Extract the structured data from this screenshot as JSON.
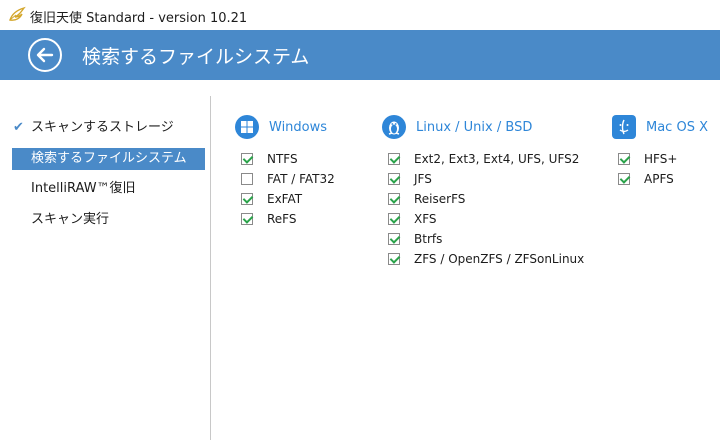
{
  "window": {
    "title": "復旧天使 Standard - version 10.21"
  },
  "header": {
    "title": "検索するファイルシステム"
  },
  "sidebar": {
    "items": [
      {
        "label": "スキャンするストレージ",
        "done": true,
        "active": false
      },
      {
        "label": "検索するファイルシステム",
        "done": false,
        "active": true
      },
      {
        "label": "IntelliRAW™復旧",
        "done": false,
        "active": false
      },
      {
        "label": "スキャン実行",
        "done": false,
        "active": false
      }
    ]
  },
  "filesystems": {
    "windows": {
      "title": "Windows",
      "icon": "windows-icon",
      "items": [
        {
          "label": "NTFS",
          "checked": true
        },
        {
          "label": "FAT / FAT32",
          "checked": false
        },
        {
          "label": "ExFAT",
          "checked": true
        },
        {
          "label": "ReFS",
          "checked": true
        }
      ]
    },
    "linux": {
      "title": "Linux / Unix / BSD",
      "icon": "linux-icon",
      "items": [
        {
          "label": "Ext2, Ext3, Ext4, UFS, UFS2",
          "checked": true
        },
        {
          "label": "JFS",
          "checked": true
        },
        {
          "label": "ReiserFS",
          "checked": true
        },
        {
          "label": "XFS",
          "checked": true
        },
        {
          "label": "Btrfs",
          "checked": true
        },
        {
          "label": "ZFS / OpenZFS / ZFSonLinux",
          "checked": true
        }
      ]
    },
    "mac": {
      "title": "Mac OS X",
      "icon": "mac-icon",
      "items": [
        {
          "label": "HFS+",
          "checked": true
        },
        {
          "label": "APFS",
          "checked": true
        }
      ]
    }
  },
  "colors": {
    "accent": "#4a8ac8",
    "icon_blue": "#2e86d8",
    "check_green": "#2aa34a"
  }
}
